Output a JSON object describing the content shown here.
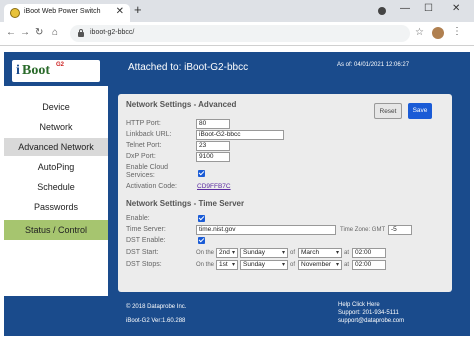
{
  "browser": {
    "tab_title": "iBoot Web Power Switch",
    "url": "iboot-g2-bbcc/"
  },
  "header": {
    "logo_text": "iBoot G2",
    "attached": "Attached to: iBoot-G2-bbcc",
    "as_of": "As of: 04/01/2021 12:06:27"
  },
  "sidebar": {
    "items": [
      {
        "label": "Device"
      },
      {
        "label": "Network"
      },
      {
        "label": "Advanced Network"
      },
      {
        "label": "AutoPing"
      },
      {
        "label": "Schedule"
      },
      {
        "label": "Passwords"
      },
      {
        "label": "Status / Control"
      }
    ]
  },
  "advanced": {
    "title": "Network Settings - Advanced",
    "reset_label": "Reset",
    "save_label": "Save",
    "http_port_label": "HTTP Port:",
    "http_port": "80",
    "linkback_label": "Linkback URL:",
    "linkback": "iBoot-G2-bbcc",
    "telnet_label": "Telnet Port:",
    "telnet": "23",
    "dxp_label": "DxP Port:",
    "dxp": "9100",
    "cloud_label_1": "Enable Cloud",
    "cloud_label_2": "Services:",
    "activation_label": "Activation Code:",
    "activation_code": "CD9FFB7C"
  },
  "time_server": {
    "title": "Network Settings - Time Server",
    "enable_label": "Enable:",
    "server_label": "Time Server:",
    "server": "time.nist.gov",
    "tz_label": "Time Zone: GMT",
    "tz": "-5",
    "dst_enable_label": "DST Enable:",
    "dst_start_label": "DST Start:",
    "dst_stops_label": "DST Stops:",
    "on_the": "On the",
    "of": "of",
    "at": "at",
    "start": {
      "ordinal": "2nd",
      "day": "Sunday",
      "month": "March",
      "time": "02:00"
    },
    "stop": {
      "ordinal": "1st",
      "day": "Sunday",
      "month": "November",
      "time": "02:00"
    }
  },
  "footer": {
    "copyright": "© 2018 Dataprobe Inc.",
    "version": "iBoot-G2 Ver:1.60.288",
    "help": "Help Click Here",
    "support": "Support:  201-934-5111",
    "email": "support@dataprobe.com"
  },
  "colors": {
    "brand_blue": "#1a4b8c",
    "save_blue": "#1a5bd6",
    "status_green": "#a6c56f"
  }
}
